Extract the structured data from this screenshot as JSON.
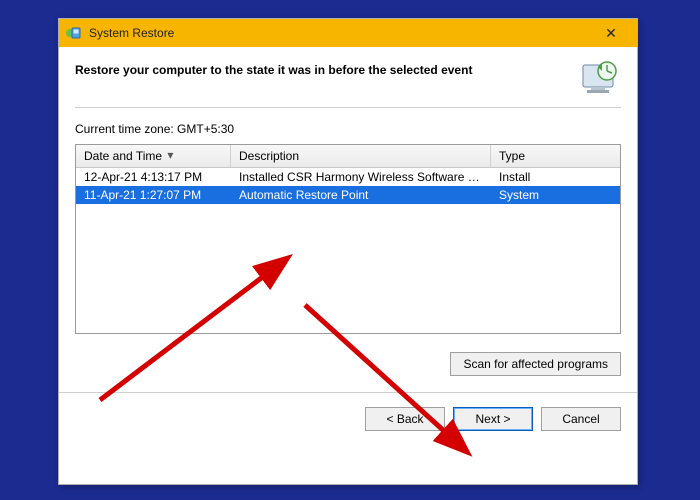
{
  "window": {
    "title": "System Restore",
    "close_glyph": "✕"
  },
  "header": {
    "text": "Restore your computer to the state it was in before the selected event"
  },
  "timezone_label": "Current time zone: GMT+5:30",
  "table": {
    "columns": {
      "datetime": "Date and Time",
      "description": "Description",
      "type": "Type"
    },
    "rows": [
      {
        "datetime": "12-Apr-21 4:13:17 PM",
        "description": "Installed CSR Harmony Wireless Software Stack.",
        "type": "Install",
        "selected": false
      },
      {
        "datetime": "11-Apr-21 1:27:07 PM",
        "description": "Automatic Restore Point",
        "type": "System",
        "selected": true
      }
    ]
  },
  "buttons": {
    "scan": "Scan for affected programs",
    "back": "< Back",
    "next": "Next >",
    "cancel": "Cancel"
  },
  "icons": {
    "app": "system-restore-icon",
    "header": "clock-monitor-icon",
    "close": "close-icon"
  }
}
